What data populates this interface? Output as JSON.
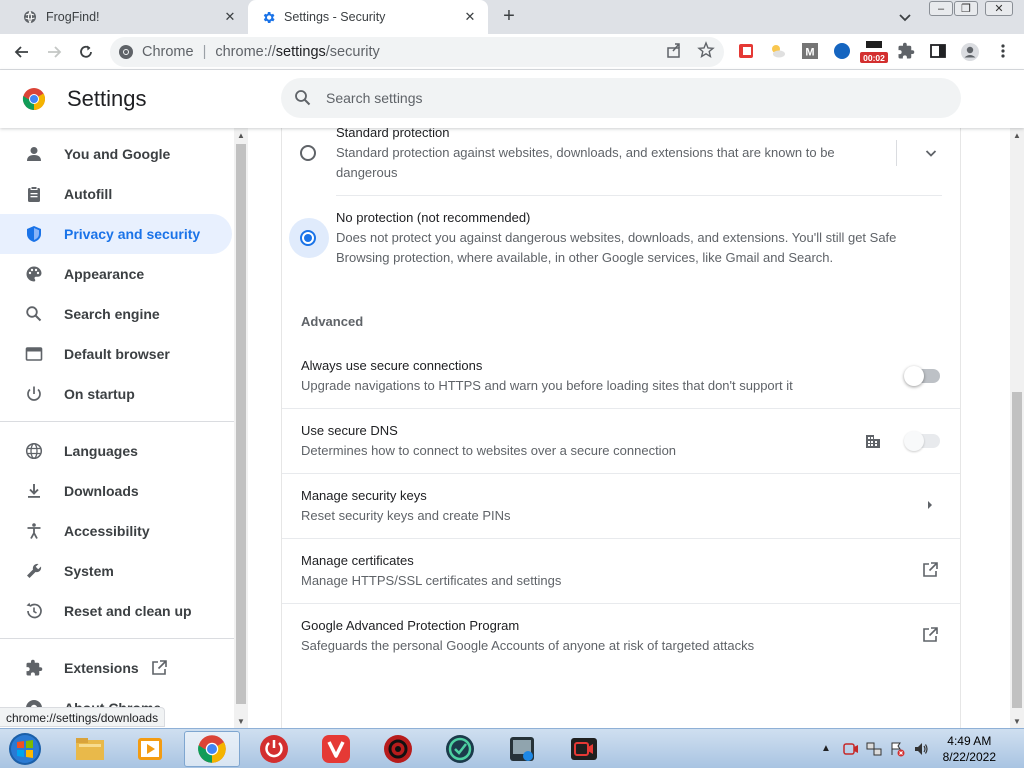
{
  "browser": {
    "tabs": [
      {
        "title": "FrogFind!",
        "active": false
      },
      {
        "title": "Settings - Security",
        "active": true
      }
    ],
    "omnibox": {
      "site_label": "Chrome",
      "url_scheme": "chrome://",
      "url_host": "settings",
      "url_path": "/security"
    },
    "extension_badge": "00:02"
  },
  "settings": {
    "title": "Settings",
    "search_placeholder": "Search settings"
  },
  "sidebar": {
    "items": [
      {
        "label": "You and Google",
        "icon": "person-icon"
      },
      {
        "label": "Autofill",
        "icon": "clipboard-icon"
      },
      {
        "label": "Privacy and security",
        "icon": "shield-icon",
        "selected": true
      },
      {
        "label": "Appearance",
        "icon": "palette-icon"
      },
      {
        "label": "Search engine",
        "icon": "search-icon"
      },
      {
        "label": "Default browser",
        "icon": "browser-icon"
      },
      {
        "label": "On startup",
        "icon": "power-icon"
      },
      {
        "label": "Languages",
        "icon": "globe-icon"
      },
      {
        "label": "Downloads",
        "icon": "download-icon"
      },
      {
        "label": "Accessibility",
        "icon": "accessibility-icon"
      },
      {
        "label": "System",
        "icon": "wrench-icon"
      },
      {
        "label": "Reset and clean up",
        "icon": "history-icon"
      },
      {
        "label": "Extensions",
        "icon": "puzzle-icon"
      },
      {
        "label": "About Chrome",
        "icon": "chrome-icon"
      }
    ]
  },
  "security": {
    "standard": {
      "title": "Standard protection",
      "desc_line1": "Standard protection against websites, downloads, and extensions that are known to be",
      "desc_line2": "dangerous",
      "selected": false
    },
    "none": {
      "title": "No protection (not recommended)",
      "desc_line1": "Does not protect you against dangerous websites, downloads, and extensions. You'll still get Safe",
      "desc_line2": "Browsing protection, where available, in other Google services, like Gmail and Search.",
      "selected": true
    },
    "advanced_header": "Advanced",
    "rows": [
      {
        "title": "Always use secure connections",
        "subtitle": "Upgrade navigations to HTTPS and warn you before loading sites that don't support it",
        "control": "toggle-off"
      },
      {
        "title": "Use secure DNS",
        "subtitle": "Determines how to connect to websites over a secure connection",
        "control": "toggle-disabled"
      },
      {
        "title": "Manage security keys",
        "subtitle": "Reset security keys and create PINs",
        "control": "arrow"
      },
      {
        "title": "Manage certificates",
        "subtitle": "Manage HTTPS/SSL certificates and settings",
        "control": "external"
      },
      {
        "title": "Google Advanced Protection Program",
        "subtitle": "Safeguards the personal Google Accounts of anyone at risk of targeted attacks",
        "control": "external"
      }
    ]
  },
  "status_url": "chrome://settings/downloads",
  "taskbar": {
    "time": "4:49 AM",
    "date": "8/22/2022"
  },
  "colors": {
    "accent": "#1a73e8",
    "selected_bg": "#e8f0fe"
  }
}
